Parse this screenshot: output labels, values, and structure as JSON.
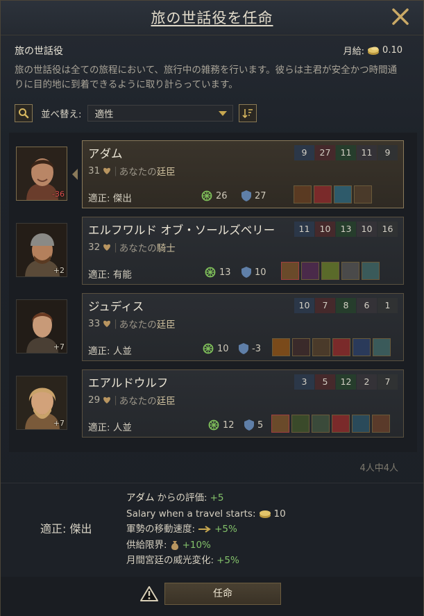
{
  "window": {
    "title": "旅の世話役を任命"
  },
  "role": {
    "heading": "旅の世話役",
    "salary_label": "月給:",
    "salary_value": "0.10",
    "description": "旅の世話役は全ての旅程において、旅行中の雑務を行います。彼らは主君が安全かつ時間通りに目的地に到着できるように取り計らっています。"
  },
  "toolbar": {
    "sort_label": "並べ替え:",
    "sort_value": "適性"
  },
  "candidates": [
    {
      "name": "アダム",
      "age": "31",
      "rel_prefix": "あなたの",
      "rel_title": "廷臣",
      "aptitude": "適正: 傑出",
      "stat1": "26",
      "stat2": "27",
      "badge": "-36",
      "skills": [
        "9",
        "27",
        "11",
        "11",
        "9"
      ]
    },
    {
      "name": "エルフワルド オブ・ソールズベリー",
      "age": "32",
      "rel_prefix": "あなたの",
      "rel_title": "騎士",
      "aptitude": "適正: 有能",
      "stat1": "13",
      "stat2": "10",
      "badge": "+2",
      "skills": [
        "11",
        "10",
        "13",
        "10",
        "16"
      ]
    },
    {
      "name": "ジュディス",
      "age": "33",
      "rel_prefix": "あなたの",
      "rel_title": "廷臣",
      "aptitude": "適正: 人並",
      "stat1": "10",
      "stat2": "-3",
      "badge": "+7",
      "skills": [
        "10",
        "7",
        "8",
        "6",
        "1"
      ]
    },
    {
      "name": "エアルドウルフ",
      "age": "29",
      "rel_prefix": "あなたの",
      "rel_title": "廷臣",
      "aptitude": "適正: 人並",
      "stat1": "12",
      "stat2": "5",
      "badge": "+7",
      "skills": [
        "3",
        "5",
        "12",
        "2",
        "7"
      ]
    }
  ],
  "count_text": "4人中4人",
  "effects": {
    "aptitude": "適正: 傑出",
    "opinion_name": "アダム",
    "opinion_text": "からの評価:",
    "opinion_value": "+5",
    "salary_text": "Salary when a travel starts:",
    "salary_value": "10",
    "speed_text": "軍勢の移動速度:",
    "speed_value": "+5%",
    "supply_text": "供給限界:",
    "supply_value": "+10%",
    "prestige_text": "月間宮廷の威光変化:",
    "prestige_value": "+5%"
  },
  "footer": {
    "appoint_label": "任命"
  },
  "colors": {
    "accent": "#c8a850",
    "positive": "#83c16a",
    "negative": "#e05050"
  },
  "icons": [
    "close-icon",
    "gold-coin-icon",
    "search-icon",
    "sort-direction-icon",
    "heart-icon",
    "travel-safety-icon",
    "shield-icon",
    "warning-icon",
    "arrow-icon",
    "money-bag-icon"
  ]
}
